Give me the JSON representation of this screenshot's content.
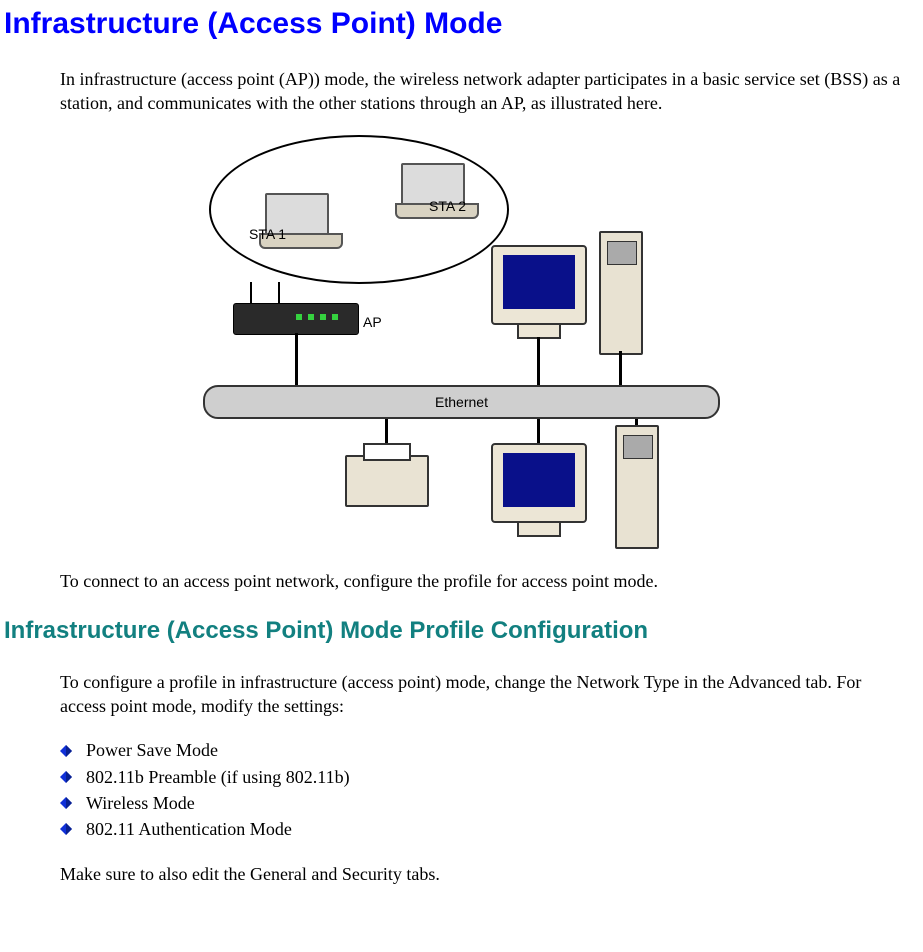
{
  "colors": {
    "heading_main": "#0000FF",
    "heading_sub": "#128080"
  },
  "headings": {
    "h1": "Infrastructure (Access Point) Mode",
    "h2": "Infrastructure (Access Point) Mode Profile Configuration"
  },
  "paragraphs": {
    "p1": "In infrastructure (access point (AP)) mode, the wireless network adapter participates in a basic service set (BSS) as a station, and communicates with the other stations through an AP, as illustrated here.",
    "p2": "To connect to an access point network, configure the profile for access point mode.",
    "p3": "To configure a profile in infrastructure (access point) mode, change the Network Type in the Advanced tab. For access point mode, modify the settings:",
    "p4": "Make sure to also edit the General and Security tabs."
  },
  "bullets": [
    "Power Save Mode",
    "802.11b Preamble (if using 802.11b)",
    "Wireless Mode",
    "802.11 Authentication Mode"
  ],
  "diagram": {
    "sta1": "STA 1",
    "sta2": "STA 2",
    "ap": "AP",
    "ethernet": "Ethernet"
  }
}
